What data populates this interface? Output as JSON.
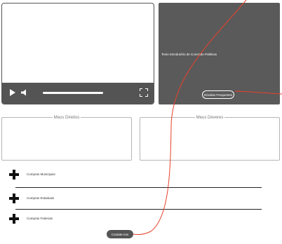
{
  "video_player": {
    "play_icon": "play-icon",
    "volume_icon": "volume-icon",
    "fullscreen_icon": "fullscreen-icon",
    "progress": 0
  },
  "info_panel": {
    "text": "Texto introdutório de Concisão Publicas",
    "faq_button": "Dúvidas Frequentes"
  },
  "rights": {
    "legend": "Meus Direitos"
  },
  "duties": {
    "legend": "Meus Deveres"
  },
  "purchases": [
    {
      "label": "Compras Municipais",
      "icon": "plus-icon"
    },
    {
      "label": "Compras Estaduais",
      "icon": "plus-icon"
    },
    {
      "label": "Compras Federais",
      "icon": "plus-icon"
    }
  ],
  "contact_button": "Contate-nos",
  "colors": {
    "dark_gray": "#555555",
    "annotation_red": "#e8412c"
  }
}
